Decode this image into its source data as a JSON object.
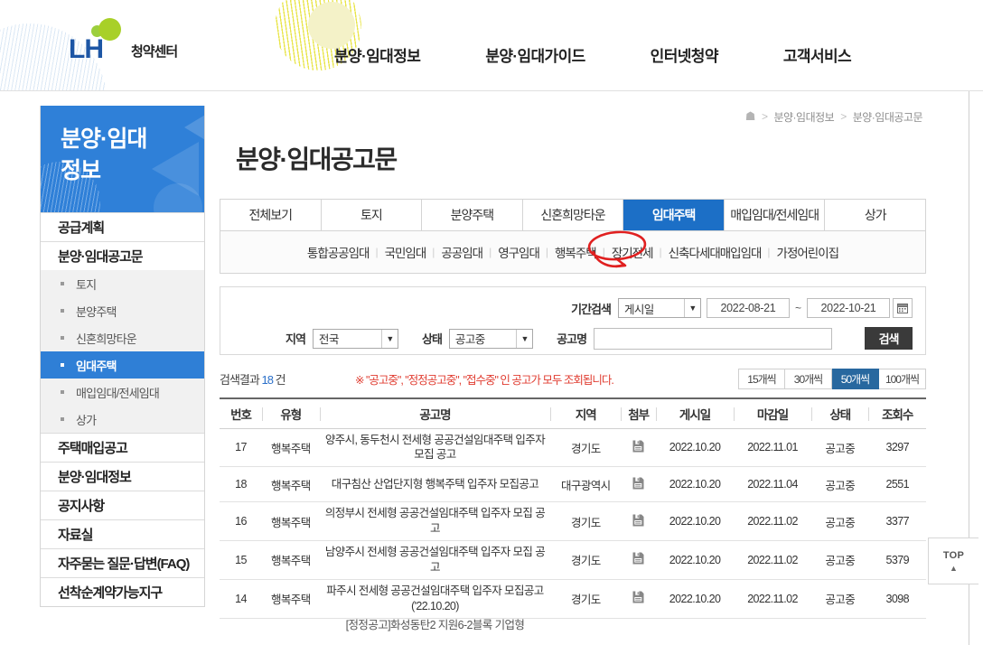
{
  "header": {
    "logo_text": "LH",
    "logo_sub": "청약센터",
    "gnb": [
      {
        "label": "분양·임대정보"
      },
      {
        "label": "분양·임대가이드"
      },
      {
        "label": "인터넷청약"
      },
      {
        "label": "고객서비스"
      }
    ]
  },
  "sidebar": {
    "title": "분양·임대\n정보",
    "items": [
      {
        "label": "공급계획",
        "type": "main"
      },
      {
        "label": "분양·임대공고문",
        "type": "main"
      },
      {
        "label": "토지",
        "type": "sub",
        "active": false
      },
      {
        "label": "분양주택",
        "type": "sub",
        "active": false
      },
      {
        "label": "신혼희망타운",
        "type": "sub",
        "active": false
      },
      {
        "label": "임대주택",
        "type": "sub",
        "active": true
      },
      {
        "label": "매입임대/전세임대",
        "type": "sub",
        "active": false
      },
      {
        "label": "상가",
        "type": "sub",
        "active": false
      },
      {
        "label": "주택매입공고",
        "type": "main"
      },
      {
        "label": "분양·임대정보",
        "type": "main"
      },
      {
        "label": "공지사항",
        "type": "main"
      },
      {
        "label": "자료실",
        "type": "main"
      },
      {
        "label": "자주묻는 질문·답변(FAQ)",
        "type": "main"
      },
      {
        "label": "선착순계약가능지구",
        "type": "main"
      }
    ]
  },
  "breadcrumb": {
    "home_icon": "home-icon",
    "items": [
      "분양·임대정보",
      "분양·임대공고문"
    ],
    "separator": ">"
  },
  "page_title": "분양·임대공고문",
  "tabs": [
    {
      "label": "전체보기",
      "active": false
    },
    {
      "label": "토지",
      "active": false
    },
    {
      "label": "분양주택",
      "active": false
    },
    {
      "label": "신혼희망타운",
      "active": false
    },
    {
      "label": "임대주택",
      "active": true
    },
    {
      "label": "매입임대/전세임대",
      "active": false
    },
    {
      "label": "상가",
      "active": false
    }
  ],
  "subtabs": [
    {
      "label": "통합공공임대",
      "active": false
    },
    {
      "label": "국민임대",
      "active": false
    },
    {
      "label": "공공임대",
      "active": false
    },
    {
      "label": "영구임대",
      "active": false
    },
    {
      "label": "행복주택",
      "active": true,
      "annotated": true
    },
    {
      "label": "장기전세",
      "active": false
    },
    {
      "label": "신축다세대매입임대",
      "active": false
    },
    {
      "label": "가정어린이집",
      "active": false
    }
  ],
  "annotation": {
    "color": "#e02020",
    "target": "행복주택"
  },
  "search": {
    "period_label": "기간검색",
    "period_type": "게시일",
    "date_from": "2022-08-21",
    "date_to": "2022-10-21",
    "tilde": "~",
    "calendar_icon": "calendar-icon",
    "region_label": "지역",
    "region_value": "전국",
    "state_label": "상태",
    "state_value": "공고중",
    "name_label": "공고명",
    "name_value": "",
    "name_placeholder": "",
    "search_button": "검색"
  },
  "results": {
    "count_prefix": "검색결과",
    "count": "18",
    "count_suffix": "건",
    "note": "※ \"공고중\", \"정정공고중\", \"접수중\" 인 공고가 모두 조회됩니다.",
    "page_sizes": [
      {
        "label": "15개씩",
        "active": false
      },
      {
        "label": "30개씩",
        "active": false
      },
      {
        "label": "50개씩",
        "active": true
      },
      {
        "label": "100개씩",
        "active": false
      }
    ]
  },
  "table": {
    "headers": [
      "번호",
      "유형",
      "공고명",
      "지역",
      "첨부",
      "게시일",
      "마감일",
      "상태",
      "조회수"
    ],
    "rows": [
      {
        "no": "17",
        "type": "행복주택",
        "name": "양주시, 동두천시 전세형 공공건설임대주택 입주자 모집 공고",
        "area": "경기도",
        "attach": "file-icon",
        "posted": "2022.10.20",
        "deadline": "2022.11.01",
        "status": "공고중",
        "views": "3297"
      },
      {
        "no": "18",
        "type": "행복주택",
        "name": "대구침산 산업단지형 행복주택 입주자 모집공고",
        "area": "대구광역시",
        "attach": "file-icon",
        "posted": "2022.10.20",
        "deadline": "2022.11.04",
        "status": "공고중",
        "views": "2551"
      },
      {
        "no": "16",
        "type": "행복주택",
        "name": "의정부시 전세형 공공건설임대주택 입주자 모집 공고",
        "area": "경기도",
        "attach": "file-icon",
        "posted": "2022.10.20",
        "deadline": "2022.11.02",
        "status": "공고중",
        "views": "3377"
      },
      {
        "no": "15",
        "type": "행복주택",
        "name": "남양주시 전세형 공공건설임대주택 입주자 모집 공고",
        "area": "경기도",
        "attach": "file-icon",
        "posted": "2022.10.20",
        "deadline": "2022.11.02",
        "status": "공고중",
        "views": "5379"
      },
      {
        "no": "14",
        "type": "행복주택",
        "name": "파주시 전세형 공공건설임대주택 입주자 모집공고('22.10.20)",
        "area": "경기도",
        "attach": "file-icon",
        "posted": "2022.10.20",
        "deadline": "2022.11.02",
        "status": "공고중",
        "views": "3098"
      }
    ],
    "partial_row": {
      "name": "[정정공고]화성동탄2 지원6-2블록 기업형"
    }
  },
  "top_button": {
    "label": "TOP",
    "arrow": "▲"
  }
}
